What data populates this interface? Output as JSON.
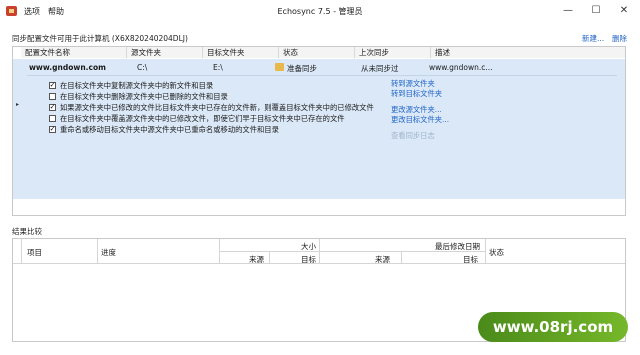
{
  "window": {
    "title": "Echosync 7.5 - 管理员",
    "menu": [
      "选项",
      "帮助"
    ],
    "minimize": "—",
    "maximize": "☐",
    "close": "✕"
  },
  "profiles": {
    "heading": "同步配置文件可用于此计算机 (X6X820240204DLJ)",
    "new_label": "新建...",
    "delete_label": "删除",
    "columns": [
      "配置文件名称",
      "源文件夹",
      "目标文件夹",
      "状态",
      "上次同步",
      "描述"
    ],
    "row": {
      "name": "www.gndown.com",
      "source": "C:\\",
      "target": "E:\\",
      "status": "准备同步",
      "last_sync": "从未同步过",
      "description": "www.gndown.c..."
    },
    "options": [
      {
        "label": "在目标文件夹中复制源文件夹中的新文件和目录",
        "checked": true
      },
      {
        "label": "在目标文件夹中删除源文件夹中已删除的文件和目录",
        "checked": false
      },
      {
        "label": "如果源文件夹中已修改的文件比目标文件夹中已存在的文件新，则覆盖目标文件夹中的已修改文件",
        "checked": true
      },
      {
        "label": "在目标文件夹中覆盖源文件夹中的已修改文件，即使它们早于目标文件夹中已存在的文件",
        "checked": false
      },
      {
        "label": "重命名或移动目标文件夹中源文件夹中已重命名或移动的文件和目录",
        "checked": true
      }
    ],
    "side_links": {
      "goto_source": "转到源文件夹",
      "goto_target": "转到目标文件夹",
      "change_source": "更改源文件夹...",
      "change_target": "更改目标文件夹...",
      "view_log": "查看同步日志"
    }
  },
  "results": {
    "heading": "结果比较",
    "col_item": "项目",
    "col_progress": "进度",
    "group_size": "大小",
    "group_modified": "最后修改日期",
    "sub_source": "来源",
    "sub_target": "目标",
    "col_status": "状态"
  },
  "watermark": "www.08rj.com",
  "colors": {
    "accent": "#1f63c6",
    "selection": "#dbe8f7",
    "watermark": "#5f9f22"
  }
}
